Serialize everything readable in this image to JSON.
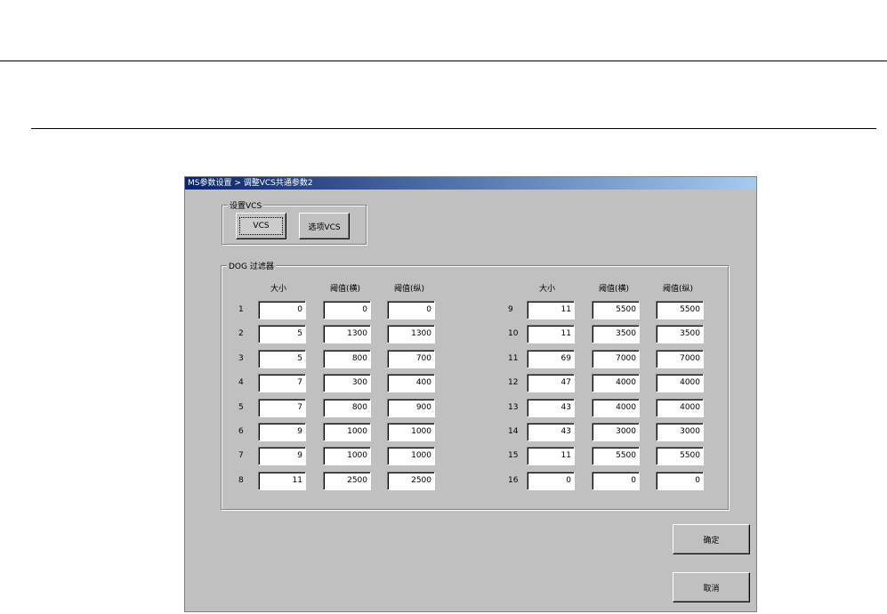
{
  "window": {
    "title": "MS参数设置 > 调整VCS共通参数2"
  },
  "vcs_group": {
    "label": "设置VCS",
    "vcs_button": "VCS",
    "option_vcs_button": "选项VCS"
  },
  "dog_group": {
    "label": "DOG 过滤器",
    "headers": [
      "大小",
      "阈值(横)",
      "阈值(纵)"
    ],
    "rows": [
      {
        "no": "1",
        "size": "0",
        "h": "0",
        "v": "0"
      },
      {
        "no": "2",
        "size": "5",
        "h": "1300",
        "v": "1300"
      },
      {
        "no": "3",
        "size": "5",
        "h": "800",
        "v": "700"
      },
      {
        "no": "4",
        "size": "7",
        "h": "300",
        "v": "400"
      },
      {
        "no": "5",
        "size": "7",
        "h": "800",
        "v": "900"
      },
      {
        "no": "6",
        "size": "9",
        "h": "1000",
        "v": "1000"
      },
      {
        "no": "7",
        "size": "9",
        "h": "1000",
        "v": "1000"
      },
      {
        "no": "8",
        "size": "11",
        "h": "2500",
        "v": "2500"
      },
      {
        "no": "9",
        "size": "11",
        "h": "5500",
        "v": "5500"
      },
      {
        "no": "10",
        "size": "11",
        "h": "3500",
        "v": "3500"
      },
      {
        "no": "11",
        "size": "69",
        "h": "7000",
        "v": "7000"
      },
      {
        "no": "12",
        "size": "47",
        "h": "4000",
        "v": "4000"
      },
      {
        "no": "13",
        "size": "43",
        "h": "4000",
        "v": "4000"
      },
      {
        "no": "14",
        "size": "43",
        "h": "3000",
        "v": "3000"
      },
      {
        "no": "15",
        "size": "11",
        "h": "5500",
        "v": "5500"
      },
      {
        "no": "16",
        "size": "0",
        "h": "0",
        "v": "0"
      }
    ]
  },
  "buttons": {
    "ok": "确定",
    "cancel": "取消"
  }
}
